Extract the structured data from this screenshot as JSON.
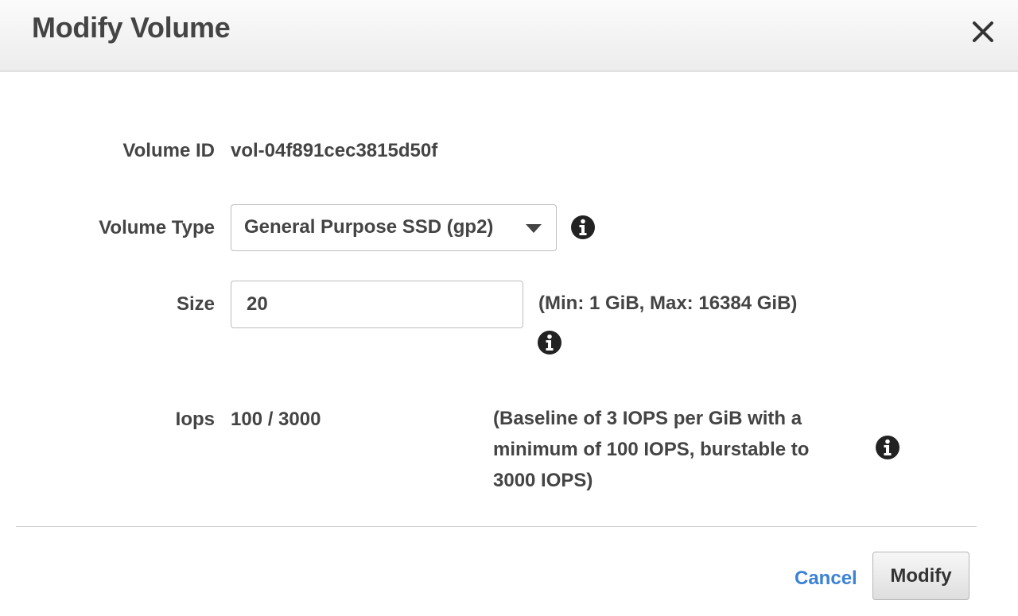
{
  "dialog": {
    "title": "Modify Volume",
    "close_icon": "close-icon"
  },
  "form": {
    "volume_id": {
      "label": "Volume ID",
      "value": "vol-04f891cec3815d50f"
    },
    "volume_type": {
      "label": "Volume Type",
      "selected": "General Purpose SSD (gp2)",
      "info_icon": "info-icon"
    },
    "size": {
      "label": "Size",
      "value": "20",
      "hint": "(Min: 1 GiB, Max: 16384 GiB)",
      "info_icon": "info-icon"
    },
    "iops": {
      "label": "Iops",
      "value": "100 / 3000",
      "hint_line1": "(Baseline of 3 IOPS per GiB with a",
      "hint_line2": "minimum of 100 IOPS, burstable to",
      "hint_line3": "3000 IOPS)",
      "info_icon": "info-icon"
    }
  },
  "footer": {
    "cancel_label": "Cancel",
    "modify_label": "Modify"
  },
  "colors": {
    "link": "#3b82d4",
    "text": "#444444",
    "border": "#bdbdbd"
  }
}
